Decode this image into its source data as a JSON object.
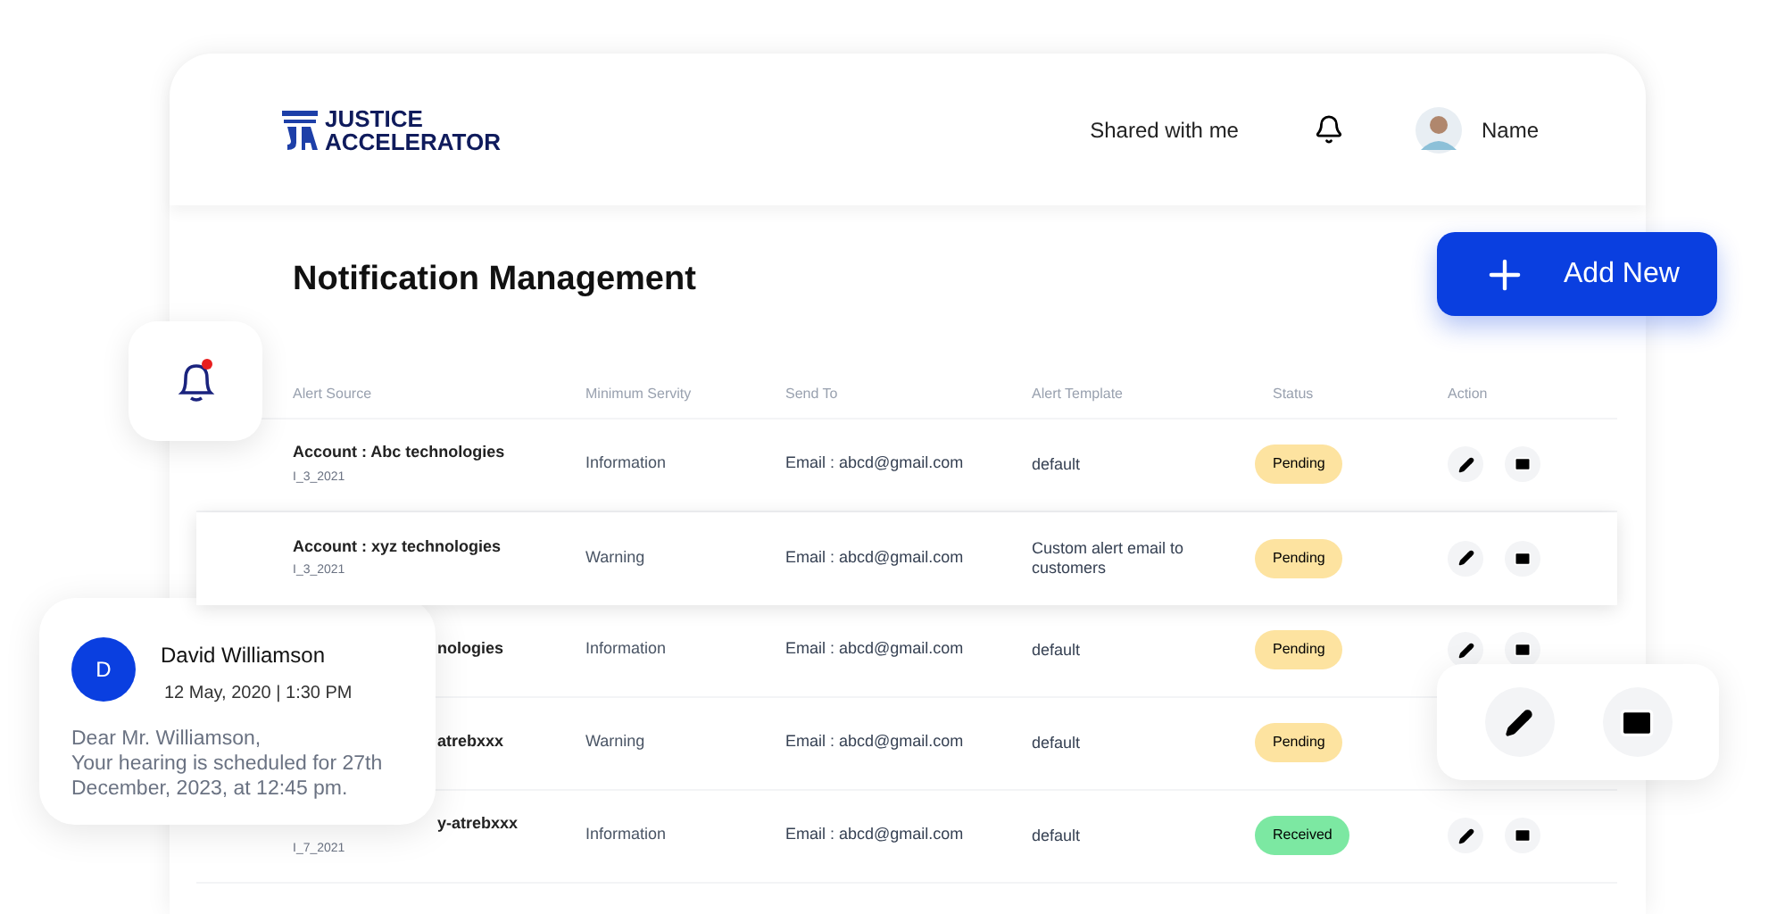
{
  "header": {
    "logo": {
      "line1": "JUSTICE",
      "line2": "ACCELERATOR"
    },
    "shared_link": "Shared with me",
    "user_name": "Name"
  },
  "title": "Notification Management",
  "add_button": "Add New",
  "bell_tile": {
    "unread": true
  },
  "table": {
    "columns": [
      "Alert Source",
      "Minimum Servity",
      "Send To",
      "Alert Template",
      "Status",
      "Action"
    ],
    "rows": [
      {
        "selected": false,
        "covered": false,
        "actions_shown": true,
        "source": "Account : Abc technologies",
        "source_id": "I_3_2021",
        "severity": "Information",
        "send_to": "Email : abcd@gmail.com",
        "template": "default",
        "status": {
          "label": "Pending",
          "color": "#fde3a0"
        }
      },
      {
        "selected": true,
        "covered": false,
        "actions_shown": true,
        "source": "Account : xyz technologies",
        "source_id": "I_3_2021",
        "severity": "Warning",
        "send_to": "Email : abcd@gmail.com",
        "template": "Custom alert email to customers",
        "status": {
          "label": "Pending",
          "color": "#fde3a0"
        }
      },
      {
        "selected": false,
        "covered": true,
        "actions_shown": true,
        "source": "nologies",
        "severity": "Information",
        "send_to": "Email : abcd@gmail.com",
        "template": "default",
        "status": {
          "label": "Pending",
          "color": "#fde3a0"
        }
      },
      {
        "selected": false,
        "covered": true,
        "actions_shown": false,
        "source": "atrebxxx",
        "severity": "Warning",
        "send_to": "Email : abcd@gmail.com",
        "template": "default",
        "status": {
          "label": "Pending",
          "color": "#fde3a0"
        }
      },
      {
        "selected": false,
        "covered": true,
        "actions_shown": true,
        "source": "y-atrebxxx",
        "source_id": "I_7_2021",
        "severity": "Information",
        "send_to": "Email : abcd@gmail.com",
        "template": "default",
        "status": {
          "label": "Received",
          "color": "#7ce8a2"
        }
      }
    ]
  },
  "notification": {
    "initial": "D",
    "sender": "David Williamson",
    "date": "12 May, 2020 | 1:30 PM",
    "message": "Dear Mr. Williamson,\n Your hearing is scheduled for 27th December, 2023, at 12:45 pm."
  }
}
